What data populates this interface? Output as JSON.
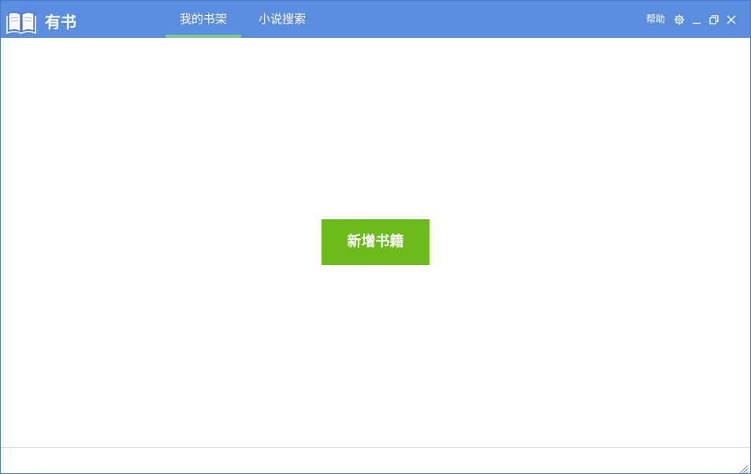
{
  "app": {
    "title": "有书",
    "logo_icon": "open-book-icon"
  },
  "tabs": [
    {
      "label": "我的书架",
      "active": true
    },
    {
      "label": "小说搜索",
      "active": false
    }
  ],
  "window_controls": {
    "help_label": "帮助",
    "icons": [
      "gear-icon",
      "minimize-icon",
      "restore-icon",
      "close-icon"
    ]
  },
  "main": {
    "add_book_label": "新增书籍"
  },
  "colors": {
    "titlebar": "#5b8ddf",
    "tab_underline": "#7cc98a",
    "add_button": "#6aba1a"
  }
}
